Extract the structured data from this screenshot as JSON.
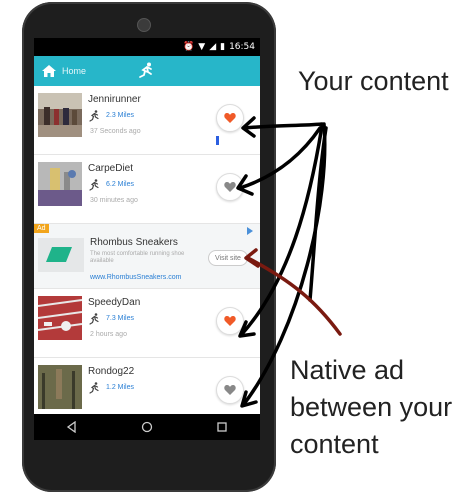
{
  "status_bar": {
    "time": "16:54"
  },
  "app_bar": {
    "home_label": "Home",
    "logo_icon": "runner-icon",
    "color": "#27b6c9"
  },
  "feed": [
    {
      "user": "Jennirunner",
      "miles": "2.3 Miles",
      "ago": "37 Seconds ago",
      "liked": true
    },
    {
      "user": "CarpeDiet",
      "miles": "6.2 Miles",
      "ago": "30 minutes ago",
      "liked": false
    }
  ],
  "ad": {
    "badge": "Ad",
    "title": "Rhombus Sneakers",
    "description": "The most comfortable running shoe available",
    "link": "www.RhombusSneakers.com",
    "button": "Visit site"
  },
  "feed2": [
    {
      "user": "SpeedyDan",
      "miles": "7.3 Miles",
      "ago": "2 hours ago",
      "liked": true
    },
    {
      "user": "Rondog22",
      "miles": "1.2 Miles",
      "ago": "",
      "liked": false
    }
  ],
  "annotations": {
    "top": "Your content",
    "bottom_line1": "Native ad",
    "bottom_line2": "between your",
    "bottom_line3": "content"
  },
  "colors": {
    "heart_liked": "#f05a28",
    "heart_unliked": "#888888",
    "arrow_black": "#000000",
    "arrow_red": "#7a1a10"
  }
}
